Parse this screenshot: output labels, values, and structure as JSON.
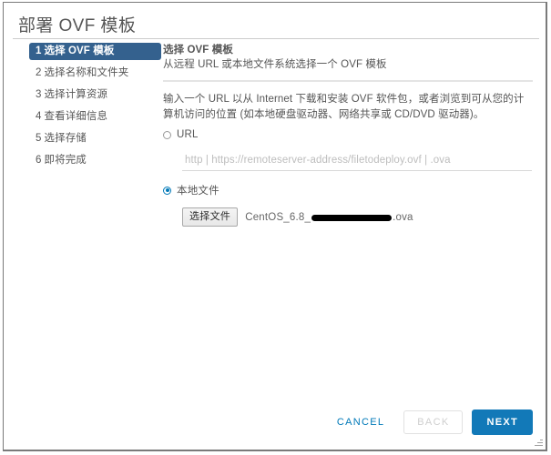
{
  "dialog": {
    "title": "部署 OVF 模板"
  },
  "steps": [
    {
      "num": "1",
      "label": "选择 OVF 模板",
      "active": true
    },
    {
      "num": "2",
      "label": "选择名称和文件夹",
      "active": false
    },
    {
      "num": "3",
      "label": "选择计算资源",
      "active": false
    },
    {
      "num": "4",
      "label": "查看详细信息",
      "active": false
    },
    {
      "num": "5",
      "label": "选择存储",
      "active": false
    },
    {
      "num": "6",
      "label": "即将完成",
      "active": false
    }
  ],
  "content": {
    "heading": "选择 OVF 模板",
    "subheading": "从远程 URL 或本地文件系统选择一个 OVF 模板",
    "paragraph": "输入一个 URL 以从 Internet 下载和安装 OVF 软件包，或者浏览到可从您的计算机访问的位置 (如本地硬盘驱动器、网络共享或 CD/DVD 驱动器)。",
    "url_option": {
      "label": "URL",
      "selected": false,
      "input_value": "",
      "placeholder": "http | https://remoteserver-address/filetodeploy.ovf | .ova"
    },
    "local_option": {
      "label": "本地文件",
      "selected": true,
      "browse_button": "选择文件",
      "file_name_prefix": "CentOS_6.8_",
      "file_name_suffix": ".ova",
      "redacted": true
    }
  },
  "footer": {
    "cancel": "Cancel",
    "back": "Back",
    "next": "Next"
  },
  "colors": {
    "accent": "#1279b8",
    "link": "#0079b8",
    "active_step_bg": "#34618e",
    "text": "#565656",
    "divider": "#e4e4e4"
  },
  "icons": {
    "resize_grip": "resize-grip-icon"
  }
}
